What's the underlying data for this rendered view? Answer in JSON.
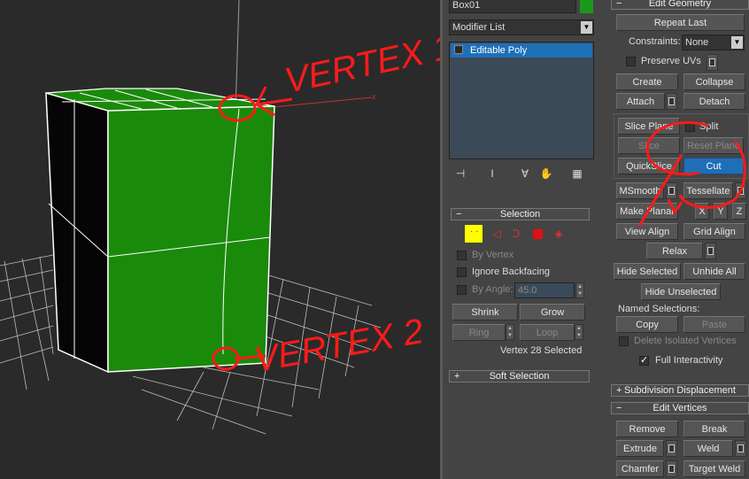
{
  "viewport": {
    "annotation1": "VERTEX 1",
    "annotation2": "VERTEX 2"
  },
  "object_name": "Box01",
  "object_color": "#1a9a1a",
  "modifier_list": {
    "label": "Modifier List",
    "item": "Editable Poly"
  },
  "stack_tools": [
    "pin-stack-icon",
    "show-end-result-icon",
    "make-unique-icon",
    "remove-modifier-icon",
    "configure-sets-icon"
  ],
  "selection": {
    "title": "Selection",
    "by_vertex": "By Vertex",
    "ignore_backfacing": "Ignore Backfacing",
    "by_angle": "By Angle:",
    "angle_value": "45.0",
    "shrink": "Shrink",
    "grow": "Grow",
    "ring": "Ring",
    "loop": "Loop",
    "status": "Vertex 28 Selected"
  },
  "soft_selection": {
    "title": "Soft Selection"
  },
  "edit_geometry": {
    "title": "Edit Geometry",
    "repeat_last": "Repeat Last",
    "constraints_label": "Constraints:",
    "constraints_value": "None",
    "preserve_uvs": "Preserve UVs",
    "create": "Create",
    "collapse": "Collapse",
    "attach": "Attach",
    "detach": "Detach",
    "slice_plane": "Slice Plane",
    "split": "Split",
    "slice": "Slice",
    "reset_plane": "Reset Plane",
    "quickslice": "QuickSlice",
    "cut": "Cut",
    "msmooth": "MSmooth",
    "tessellate": "Tessellate",
    "make_planar": "Make Planar",
    "x": "X",
    "y": "Y",
    "z": "Z",
    "view_align": "View Align",
    "grid_align": "Grid Align",
    "relax": "Relax",
    "hide_selected": "Hide Selected",
    "unhide_all": "Unhide All",
    "hide_unselected": "Hide Unselected",
    "named_selections": "Named Selections:",
    "copy": "Copy",
    "paste": "Paste",
    "delete_isolated": "Delete Isolated Vertices",
    "full_interactivity": "Full Interactivity"
  },
  "subdivision_displacement": {
    "title": "Subdivision Displacement"
  },
  "edit_vertices": {
    "title": "Edit Vertices",
    "remove": "Remove",
    "break": "Break",
    "extrude": "Extrude",
    "weld": "Weld",
    "chamfer": "Chamfer",
    "target_weld": "Target Weld"
  },
  "colors": {
    "annotation": "#ff1a1a",
    "accent": "#1f6fb7",
    "mesh": "#1a8a0a"
  }
}
